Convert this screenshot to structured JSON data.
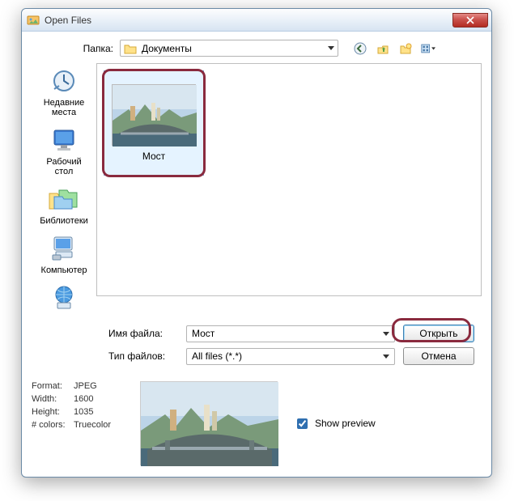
{
  "title": "Open Files",
  "folder": {
    "label": "Папка:",
    "value": "Документы"
  },
  "toolbar": {
    "back": "back-icon",
    "up": "up-icon",
    "new": "new-folder-icon",
    "view": "view-menu-icon"
  },
  "places": {
    "recent": "Недавние\nместа",
    "desktop": "Рабочий стол",
    "libraries": "Библиотеки",
    "computer": "Компьютер",
    "network": ""
  },
  "file": {
    "name": "Мост"
  },
  "fields": {
    "filename_label": "Имя файла:",
    "filename_value": "Мост",
    "filetype_label": "Тип файлов:",
    "filetype_value": "All files (*.*)"
  },
  "buttons": {
    "open": "Открыть",
    "cancel": "Отмена"
  },
  "info": {
    "format_label": "Format:",
    "format_value": "JPEG",
    "width_label": "Width:",
    "width_value": "1600",
    "height_label": "Height:",
    "height_value": "1035",
    "colors_label": "# colors:",
    "colors_value": "Truecolor"
  },
  "preview": {
    "checkbox_label": "Show preview",
    "checked": true
  }
}
